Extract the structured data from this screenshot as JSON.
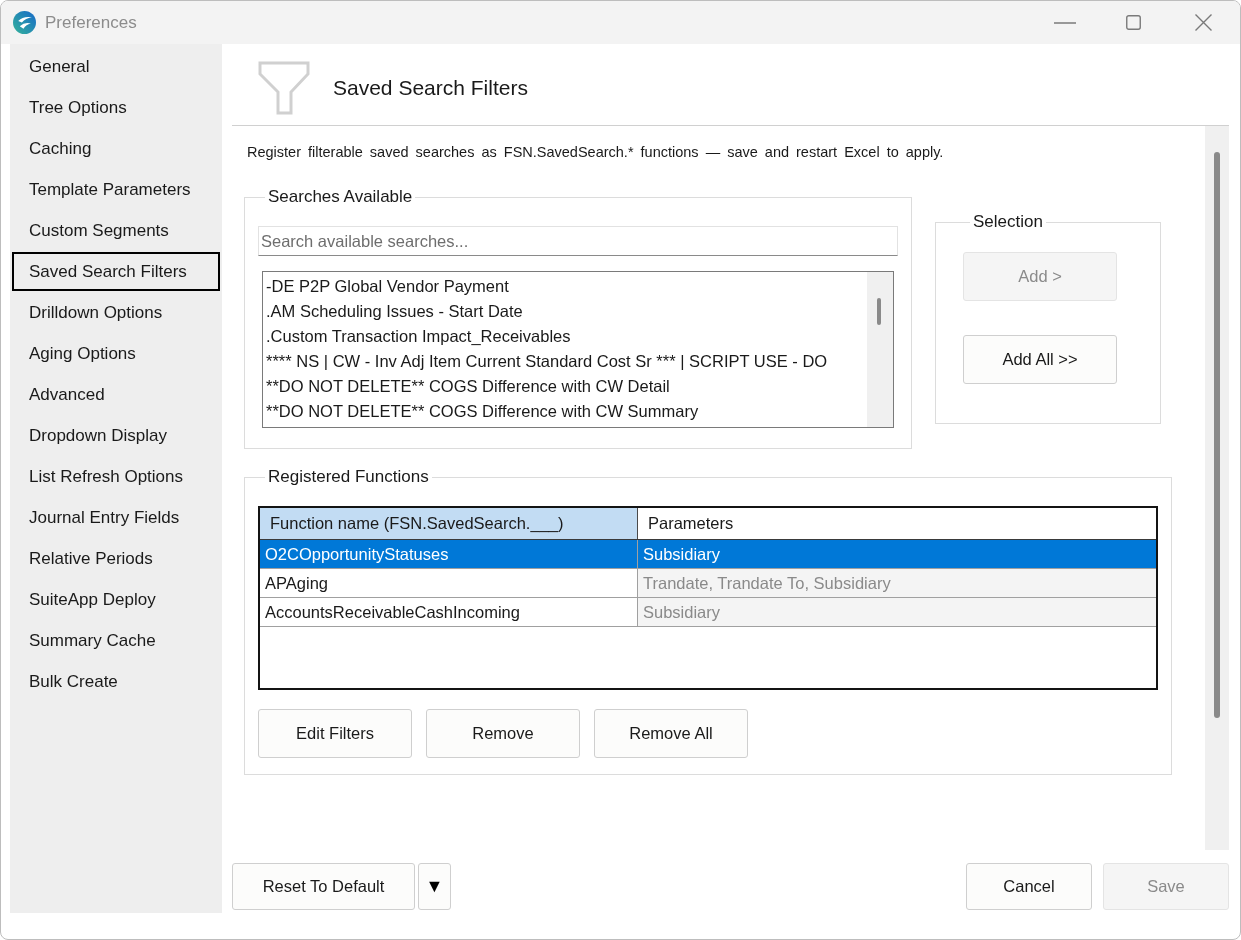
{
  "window": {
    "title": "Preferences"
  },
  "sidebar": {
    "items": [
      {
        "label": "General",
        "selected": false
      },
      {
        "label": "Tree Options",
        "selected": false
      },
      {
        "label": "Caching",
        "selected": false
      },
      {
        "label": "Template Parameters",
        "selected": false
      },
      {
        "label": "Custom Segments",
        "selected": false
      },
      {
        "label": "Saved Search Filters",
        "selected": true
      },
      {
        "label": "Drilldown Options",
        "selected": false
      },
      {
        "label": "Aging Options",
        "selected": false
      },
      {
        "label": "Advanced",
        "selected": false
      },
      {
        "label": "Dropdown Display",
        "selected": false
      },
      {
        "label": "List Refresh Options",
        "selected": false
      },
      {
        "label": "Journal Entry Fields",
        "selected": false
      },
      {
        "label": "Relative Periods",
        "selected": false
      },
      {
        "label": "SuiteApp Deploy",
        "selected": false
      },
      {
        "label": "Summary Cache",
        "selected": false
      },
      {
        "label": "Bulk Create",
        "selected": false
      }
    ]
  },
  "page": {
    "title": "Saved Search Filters",
    "description": "Register filterable saved searches as FSN.SavedSearch.* functions — save and restart Excel to apply."
  },
  "searches_available": {
    "title": "Searches Available",
    "search": {
      "placeholder": "Search available searches..."
    },
    "items": [
      {
        "label": "-DE P2P Global Vendor Payment",
        "selected": false
      },
      {
        "label": ".AM Scheduling Issues - Start Date",
        "selected": false
      },
      {
        "label": ".Custom Transaction Impact_Receivables",
        "selected": false
      },
      {
        "label": "**** NS | CW - Inv Adj Item Current Standard Cost Sr *** | SCRIPT USE - DO",
        "selected": false
      },
      {
        "label": "**DO NOT DELETE** COGS Difference with CW Detail",
        "selected": false
      },
      {
        "label": "**DO NOT DELETE** COGS Difference with CW Summary",
        "selected": false
      }
    ]
  },
  "selection": {
    "title": "Selection",
    "buttons": [
      {
        "label": "Add >",
        "disabled": true
      },
      {
        "label": "Add All >>",
        "disabled": false
      }
    ]
  },
  "registered_functions": {
    "title": "Registered Functions",
    "table": {
      "columns": [
        {
          "label": "Function name (FSN.SavedSearch.___)",
          "selected": true,
          "read_only": false
        },
        {
          "label": "Parameters",
          "selected": false,
          "read_only": true
        }
      ],
      "rows": [
        {
          "cells": [
            "O2COpportunityStatuses",
            "Subsidiary"
          ],
          "selected": true
        },
        {
          "cells": [
            "APAging",
            "Trandate, Trandate To, Subsidiary"
          ],
          "selected": false
        },
        {
          "cells": [
            "AccountsReceivableCashIncoming",
            "Subsidiary"
          ],
          "selected": false
        }
      ]
    },
    "buttons": [
      {
        "label": "Edit Filters",
        "disabled": false
      },
      {
        "label": "Remove",
        "disabled": false
      },
      {
        "label": "Remove All",
        "disabled": false
      }
    ]
  },
  "footer": {
    "left_buttons": [
      {
        "label": "Reset To Default",
        "disabled": false
      },
      {
        "label": "▼",
        "disabled": false
      }
    ],
    "right_buttons": [
      {
        "label": "Cancel",
        "disabled": false
      },
      {
        "label": "Save",
        "disabled": true
      }
    ]
  }
}
